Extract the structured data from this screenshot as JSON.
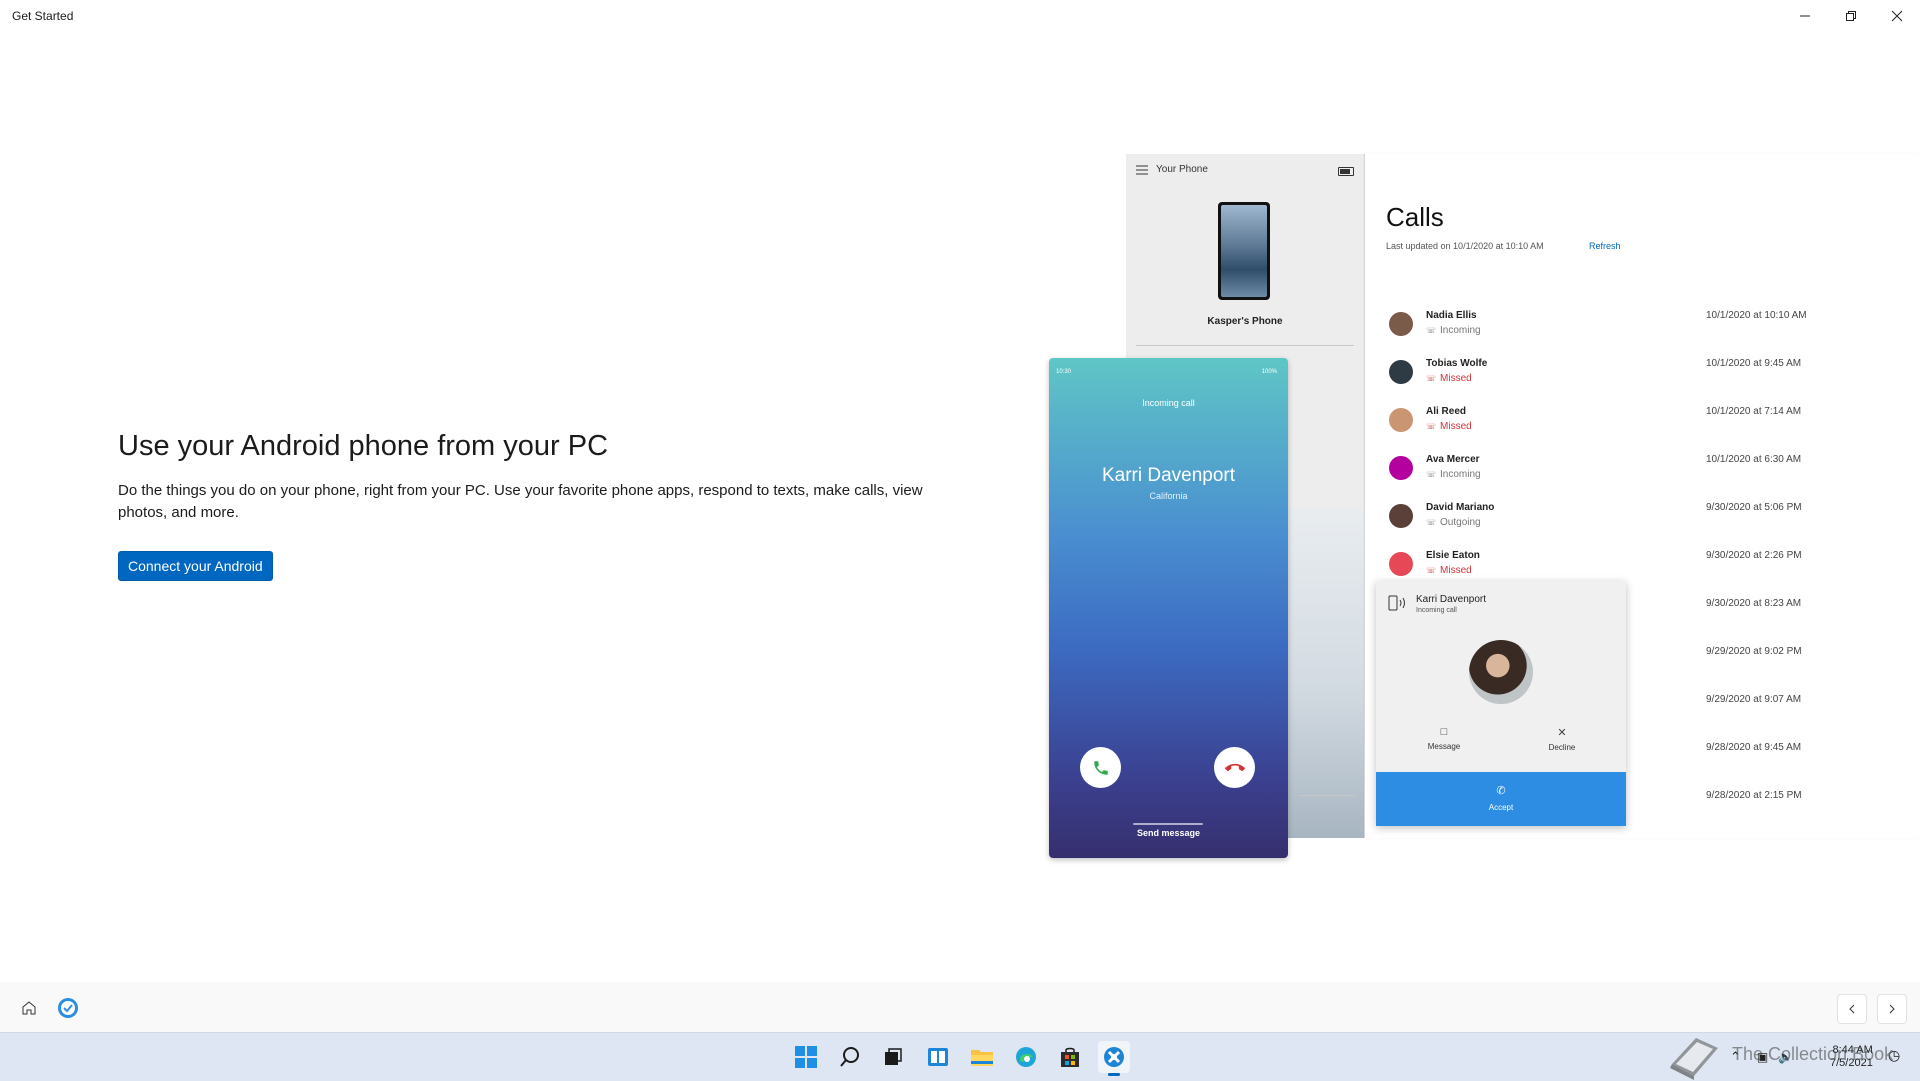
{
  "window": {
    "title": "Get Started"
  },
  "main": {
    "headline": "Use your Android phone from your PC",
    "description": "Do the things you do on your phone, right from your PC. Use your favorite phone apps, respond to texts, make calls, view photos, and more.",
    "connect_button": "Connect your Android"
  },
  "illustration": {
    "app_title": "Your Phone",
    "phone_name": "Kasper's Phone",
    "calls_title": "Calls",
    "last_updated": "Last updated on 10/1/2020 at 10:10 AM",
    "refresh": "Refresh",
    "calls": [
      {
        "name": "Nadia Ellis",
        "status": "Incoming",
        "time": "10/1/2020 at 10:10 AM",
        "missed": false
      },
      {
        "name": "Tobias Wolfe",
        "status": "Missed",
        "time": "10/1/2020 at 9:45 AM",
        "missed": true
      },
      {
        "name": "Ali Reed",
        "status": "Missed",
        "time": "10/1/2020 at 7:14 AM",
        "missed": true
      },
      {
        "name": "Ava Mercer",
        "status": "Incoming",
        "time": "10/1/2020 at 6:30 AM",
        "missed": false
      },
      {
        "name": "David Mariano",
        "status": "Outgoing",
        "time": "9/30/2020 at 5:06 PM",
        "missed": false
      },
      {
        "name": "Elsie Eaton",
        "status": "Missed",
        "time": "9/30/2020 at 2:26 PM",
        "missed": true
      },
      {
        "name": "",
        "status": "",
        "time": "9/30/2020 at 8:23 AM",
        "missed": false
      },
      {
        "name": "",
        "status": "",
        "time": "9/29/2020 at 9:02 PM",
        "missed": false
      },
      {
        "name": "",
        "status": "",
        "time": "9/29/2020 at 9:07 AM",
        "missed": false
      },
      {
        "name": "",
        "status": "",
        "time": "9/28/2020 at 9:45 AM",
        "missed": false
      },
      {
        "name": "",
        "status": "",
        "time": "9/28/2020 at 2:15 PM",
        "missed": false
      }
    ],
    "toast": {
      "caller": "Karri Davenport",
      "subtitle": "Incoming call",
      "message": "Message",
      "decline": "Decline",
      "accept": "Accept"
    },
    "android_screen": {
      "status_left": "10:30",
      "status_right": "100%",
      "incoming_label": "Incoming call",
      "caller": "Karri Davenport",
      "location": "California",
      "send_message": "Send message"
    }
  },
  "taskbar": {
    "apps": [
      "start-icon",
      "search-icon",
      "task-view-icon",
      "widgets-icon",
      "file-explorer-icon",
      "edge-icon",
      "store-icon",
      "get-started-icon"
    ],
    "time": "8:44 AM",
    "date": "7/5/2021"
  },
  "watermark": {
    "text": "The Collection Book"
  }
}
